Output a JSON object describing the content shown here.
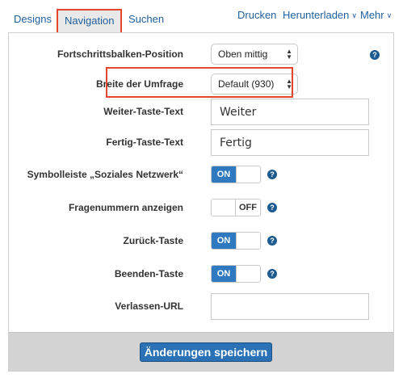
{
  "tabs": [
    {
      "label": "Designs"
    },
    {
      "label": "Navigation"
    },
    {
      "label": "Suchen"
    }
  ],
  "actions": {
    "print": "Drucken",
    "download": "Herunterladen",
    "more": "Mehr"
  },
  "fields": {
    "progress_position": {
      "label": "Fortschrittsbalken-Position",
      "value": "Oben mittig"
    },
    "survey_width": {
      "label": "Breite der Umfrage",
      "value": "Default (930)"
    },
    "next_text": {
      "label": "Weiter-Taste-Text",
      "value": "Weiter"
    },
    "done_text": {
      "label": "Fertig-Taste-Text",
      "value": "Fertig"
    },
    "social_toolbar": {
      "label": "Symbolleiste „Soziales Netzwerk“",
      "state": "ON"
    },
    "question_numbers": {
      "label": "Fragenummern anzeigen",
      "state": "OFF"
    },
    "back_button": {
      "label": "Zurück-Taste",
      "state": "ON"
    },
    "exit_button": {
      "label": "Beenden-Taste",
      "state": "ON"
    },
    "exit_url": {
      "label": "Verlassen-URL",
      "value": ""
    }
  },
  "save_label": "Änderungen speichern",
  "colors": {
    "link": "#1f5f9c",
    "toggle_on": "#2f79c1",
    "highlight": "#e6452d",
    "primary_button": "#2a72b5"
  }
}
